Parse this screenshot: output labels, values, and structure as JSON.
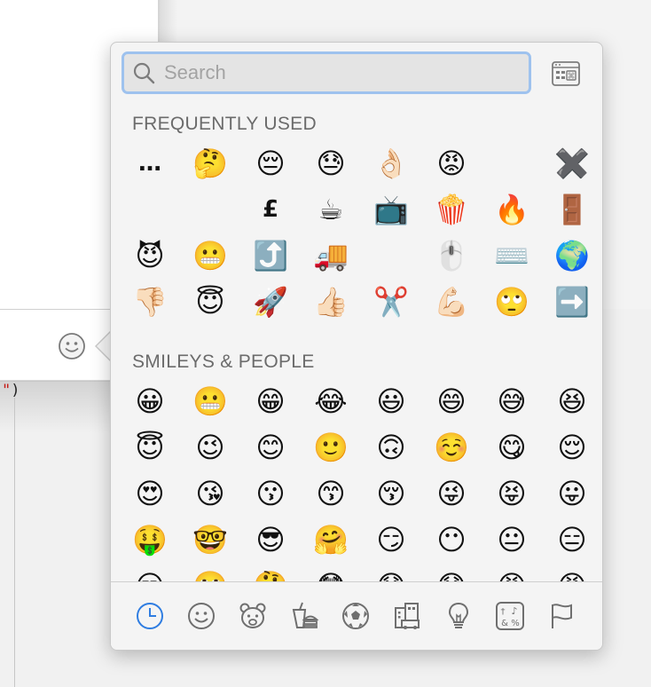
{
  "background": {
    "code_line": {
      "quote": "\"",
      "paren": ")"
    }
  },
  "picker": {
    "search_placeholder": "Search",
    "sections": [
      {
        "title": "FREQUENTLY USED",
        "items": [
          "…",
          "🤔",
          "😔",
          "😓",
          "👌🏻",
          "😡",
          "",
          "✖️",
          "",
          "",
          "£",
          "☕",
          "📺",
          "🍿",
          "🔥",
          "🚪",
          "😈",
          "😬",
          "⤴️",
          "🚚",
          "",
          "🖱️",
          "⌨️",
          "🌍",
          "👎🏻",
          "😇",
          "🚀",
          "👍🏻",
          "✂️",
          "💪🏻",
          "🙄",
          "➡️"
        ]
      },
      {
        "title": "SMILEYS & PEOPLE",
        "items": [
          "😀",
          "😬",
          "😁",
          "😂",
          "😃",
          "😄",
          "😅",
          "😆",
          "😇",
          "😉",
          "😊",
          "🙂",
          "🙃",
          "☺️",
          "😋",
          "😌",
          "😍",
          "😘",
          "😗",
          "😙",
          "😚",
          "😜",
          "😝",
          "😛",
          "🤑",
          "🤓",
          "😎",
          "🤗",
          "😏",
          "😶",
          "😐",
          "😑",
          "😒",
          "🙄",
          "🤔",
          "😳",
          "😞",
          "😟",
          "😠",
          "😡"
        ]
      }
    ],
    "categories": [
      {
        "name": "frequently-used",
        "icon": "clock-icon",
        "active": true
      },
      {
        "name": "smileys-people",
        "icon": "smiley-icon"
      },
      {
        "name": "animals-nature",
        "icon": "bear-icon"
      },
      {
        "name": "food-drink",
        "icon": "food-icon"
      },
      {
        "name": "activity",
        "icon": "soccer-ball-icon"
      },
      {
        "name": "travel-places",
        "icon": "buildings-icon"
      },
      {
        "name": "objects",
        "icon": "lightbulb-icon"
      },
      {
        "name": "symbols",
        "icon": "symbols-icon"
      },
      {
        "name": "flags",
        "icon": "flag-icon"
      }
    ],
    "colors": {
      "accent": "#2f7de1",
      "tab_icon": "#6f6f6f",
      "search_focus": "#9ec2ee"
    }
  }
}
